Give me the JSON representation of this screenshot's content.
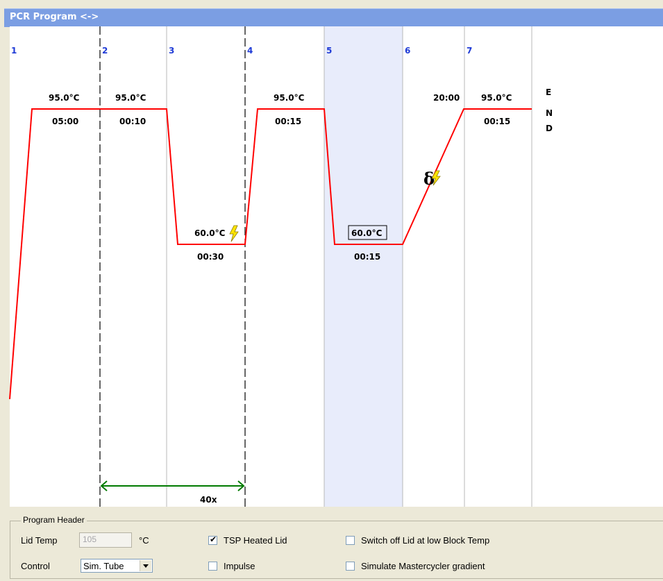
{
  "title": "PCR Program <->",
  "program": {
    "steps": [
      {
        "number": "1",
        "temp": "95.0°C",
        "time": "05:00"
      },
      {
        "number": "2",
        "temp": "95.0°C",
        "time": "00:10"
      },
      {
        "number": "3",
        "temp": "60.0°C",
        "time": "00:30"
      },
      {
        "number": "4",
        "temp": "95.0°C",
        "time": "00:15"
      },
      {
        "number": "5",
        "temp": "60.0°C",
        "time": "00:15"
      },
      {
        "number": "6",
        "time": "20:00"
      },
      {
        "number": "7",
        "temp": "95.0°C",
        "time": "00:15"
      }
    ],
    "end_letters": [
      "E",
      "N",
      "D"
    ],
    "loop_label": "40x"
  },
  "colors": {
    "profile_line": "#ff0000",
    "loop_arrow": "#007a00",
    "step_number": "#1f3bd6",
    "selected_step": "#e8ecfb",
    "titlebar": "#7b9ee3"
  },
  "header": {
    "group_title": "Program Header",
    "lid_temp_label": "Lid Temp",
    "lid_temp_value": "105",
    "lid_temp_unit": "°C",
    "control_label": "Control",
    "control_value": "Sim. Tube",
    "tsp_heated_lid": {
      "label": "TSP Heated Lid",
      "checked": true
    },
    "impulse": {
      "label": "Impulse",
      "checked": false
    },
    "switch_off_lid": {
      "label": "Switch off Lid at low Block Temp",
      "checked": false
    },
    "simulate_gradient": {
      "label": "Simulate Mastercycler gradient",
      "checked": false
    }
  }
}
